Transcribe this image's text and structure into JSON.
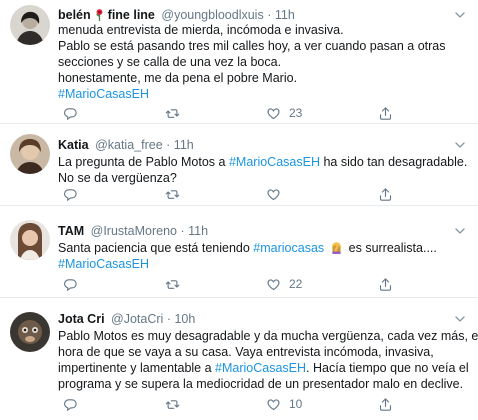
{
  "tweets": [
    {
      "name": "belén",
      "handle": "@youngbloodlxuis",
      "time": "11h",
      "name_suffix": "fine line",
      "lines": [
        "menuda entrevista de mierda, incómoda e invasiva.",
        "Pablo se está pasando tres mil calles hoy, a ver cuando pasan a otras",
        "secciones y se calla de una vez la boca.",
        "honestamente, me da pena el pobre Mario."
      ],
      "hashtag": "#MarioCasasEH",
      "replies": "",
      "retweets": "",
      "likes": "23"
    },
    {
      "name": "Katia",
      "handle": "@katia_free",
      "time": "11h",
      "line1_pre": "La pregunta de Pablo Motos a ",
      "line1_tag": "#MarioCasasEH",
      "line1_post": " ha sido tan desagradable.",
      "line2": "No se da vergüenza?",
      "replies": "",
      "retweets": "",
      "likes": ""
    },
    {
      "name": "TAM",
      "handle": "@IrustaMoreno",
      "time": "11h",
      "line1_pre": "Santa paciencia que está teniendo ",
      "line1_tag": "#mariocasas",
      "line1_post": " es surrealista....",
      "hashtag": "#MarioCasasEH",
      "replies": "",
      "retweets": "",
      "likes": "22"
    },
    {
      "name": "Jota Cri",
      "handle": "@JotaCri",
      "time": "10h",
      "line1": "Pablo Motos es muy desagradable y da mucha vergüenza, cada vez más, es",
      "line2": "hora de que se vaya a su casa. Vaya entrevista incómoda, invasiva,",
      "line3_pre": "impertinente y lamentable a ",
      "line3_tag": "#MarioCasasEH",
      "line3_post": ". Hacía tiempo que no veía el",
      "line4": "programa y se supera la mediocridad de un presentador malo en declive.",
      "replies": "",
      "retweets": "",
      "likes": "10"
    }
  ],
  "separator": "·",
  "icons": {
    "reply": "reply-icon",
    "retweet": "retweet-icon",
    "like": "heart-icon",
    "share": "share-icon",
    "caret": "chevron-down-icon"
  },
  "colors": {
    "link": "#1b95e0",
    "muted": "#657786",
    "border": "#e6ecf0"
  }
}
